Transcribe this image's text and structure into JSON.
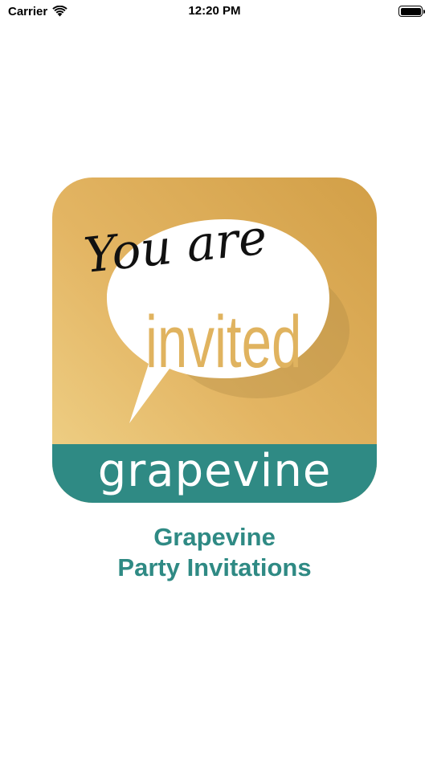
{
  "status_bar": {
    "carrier": "Carrier",
    "time": "12:20 PM",
    "battery_level": 1.0,
    "icons": [
      "wifi-icon",
      "battery-icon"
    ]
  },
  "app_icon": {
    "script_line": "You are",
    "main_word": "invited",
    "band_label": "grapevine",
    "colors": {
      "gold_light": "#f0d38a",
      "gold_dark": "#d29f47",
      "teal": "#2f8a84",
      "bubble": "#ffffff",
      "invited": "#e0b35f"
    }
  },
  "app_name": {
    "line1": "Grapevine",
    "line2": "Party Invitations"
  }
}
